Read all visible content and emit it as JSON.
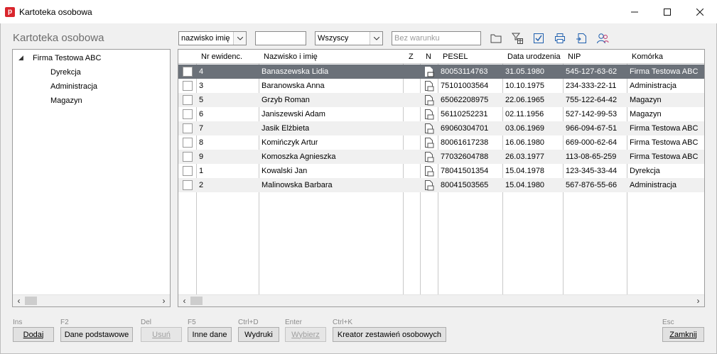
{
  "window": {
    "title": "Kartoteka osobowa",
    "app_icon_letter": "p",
    "accent_color": "#d9262d"
  },
  "panel_title": "Kartoteka osobowa",
  "filters": {
    "sort_field": "nazwisko imię",
    "scope": "Wszyscy",
    "search_value": "",
    "condition_placeholder": "Bez warunku"
  },
  "toolbar_icons": [
    "folder-icon",
    "filter-table-icon",
    "checkbox-icon",
    "print-icon",
    "export-icon",
    "people-icon"
  ],
  "tree": {
    "root": "Firma Testowa ABC",
    "children": [
      "Dyrekcja",
      "Administracja",
      "Magazyn"
    ]
  },
  "grid": {
    "columns": [
      "Nr ewidenc.",
      "Nazwisko i imię",
      "Z",
      "N",
      "PESEL",
      "Data urodzenia",
      "NIP",
      "Komórka"
    ],
    "selected_row_color": "#6b7179",
    "rows": [
      {
        "nr": "4",
        "name": "Banaszewska Lidia",
        "pesel": "80053114763",
        "dob": "31.05.1980",
        "nip": "545-127-63-62",
        "unit": "Firma Testowa ABC"
      },
      {
        "nr": "3",
        "name": "Baranowska Anna",
        "pesel": "75101003564",
        "dob": "10.10.1975",
        "nip": "234-333-22-11",
        "unit": "Administracja"
      },
      {
        "nr": "5",
        "name": "Grzyb Roman",
        "pesel": "65062208975",
        "dob": "22.06.1965",
        "nip": "755-122-64-42",
        "unit": "Magazyn"
      },
      {
        "nr": "6",
        "name": "Janiszewski Adam",
        "pesel": "56110252231",
        "dob": "02.11.1956",
        "nip": "527-142-99-53",
        "unit": "Magazyn"
      },
      {
        "nr": "7",
        "name": "Jasik Elżbieta",
        "pesel": "69060304701",
        "dob": "03.06.1969",
        "nip": "966-094-67-51",
        "unit": "Firma Testowa ABC"
      },
      {
        "nr": "8",
        "name": "Komińczyk Artur",
        "pesel": "80061617238",
        "dob": "16.06.1980",
        "nip": "669-000-62-64",
        "unit": "Firma Testowa ABC"
      },
      {
        "nr": "9",
        "name": "Komoszka Agnieszka",
        "pesel": "77032604788",
        "dob": "26.03.1977",
        "nip": "113-08-65-259",
        "unit": "Firma Testowa ABC"
      },
      {
        "nr": "1",
        "name": "Kowalski Jan",
        "pesel": "78041501354",
        "dob": "15.04.1978",
        "nip": "123-345-33-44",
        "unit": "Dyrekcja"
      },
      {
        "nr": "2",
        "name": "Malinowska Barbara",
        "pesel": "80041503565",
        "dob": "15.04.1980",
        "nip": "567-876-55-66",
        "unit": "Administracja"
      }
    ]
  },
  "buttons": {
    "add": {
      "key": "Ins",
      "label": "Dodaj"
    },
    "basic": {
      "key": "F2",
      "label": "Dane podstawowe"
    },
    "remove": {
      "key": "Del",
      "label": "Usuń",
      "disabled": true
    },
    "other": {
      "key": "F5",
      "label": "Inne dane"
    },
    "prints": {
      "key": "Ctrl+D",
      "label": "Wydruki"
    },
    "choose": {
      "key": "Enter",
      "label": "Wybierz",
      "disabled": true
    },
    "creator": {
      "key": "Ctrl+K",
      "label": "Kreator zestawień osobowych"
    },
    "close": {
      "key": "Esc",
      "label": "Zamknij"
    }
  }
}
